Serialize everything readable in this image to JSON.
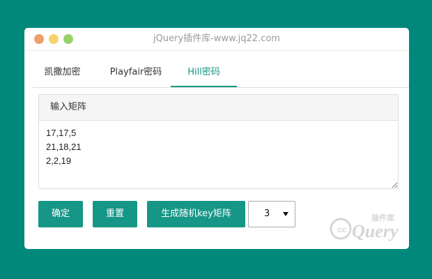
{
  "window": {
    "title": "jQuery插件库-www.jq22.com"
  },
  "tabs": [
    {
      "label": "凯撒加密"
    },
    {
      "label": "Playfair密码"
    },
    {
      "label": "Hill密码",
      "active": true
    }
  ],
  "panel": {
    "heading": "输入矩阵",
    "matrix_text": "17,17,5\n21,18,21\n2,2,19"
  },
  "buttons": {
    "confirm": "确定",
    "reset": "重置",
    "generate": "生成随机key矩阵"
  },
  "size_select": {
    "selected": "3"
  },
  "watermark": {
    "text": "jQuery",
    "sub": "插件库"
  },
  "colors": {
    "background": "#00897b",
    "accent": "#169686"
  }
}
